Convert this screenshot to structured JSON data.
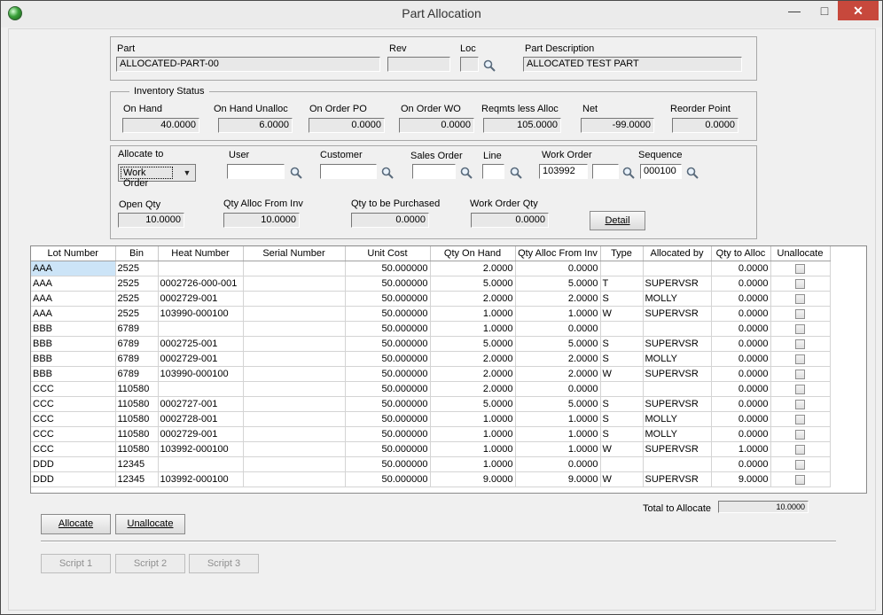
{
  "window": {
    "title": "Part Allocation",
    "min_glyph": "—",
    "max_glyph": "□",
    "close_glyph": "✕"
  },
  "part": {
    "part_label": "Part",
    "part_value": "ALLOCATED-PART-00",
    "rev_label": "Rev",
    "rev_value": "",
    "loc_label": "Loc",
    "loc_value": "",
    "desc_label": "Part Description",
    "desc_value": "ALLOCATED TEST PART"
  },
  "inventory": {
    "legend": "Inventory Status",
    "fields": [
      {
        "label": "On Hand",
        "value": "40.0000"
      },
      {
        "label": "On Hand Unalloc",
        "value": "6.0000"
      },
      {
        "label": "On Order PO",
        "value": "0.0000"
      },
      {
        "label": "On Order WO",
        "value": "0.0000"
      },
      {
        "label": "Reqmts less Alloc",
        "value": "105.0000"
      },
      {
        "label": "Net",
        "value": "-99.0000"
      },
      {
        "label": "Reorder Point",
        "value": "0.0000"
      }
    ]
  },
  "allocate": {
    "allocate_to_label": "Allocate to",
    "allocate_to_value": "Work Order",
    "user_label": "User",
    "user_value": "",
    "customer_label": "Customer",
    "customer_value": "",
    "sales_order_label": "Sales Order",
    "sales_order_value": "",
    "line_label": "Line",
    "line_value": "",
    "work_order_label": "Work Order",
    "work_order_value": "103992",
    "work_order_suffix": "",
    "sequence_label": "Sequence",
    "sequence_value": "000100",
    "open_qty_label": "Open Qty",
    "open_qty_value": "10.0000",
    "qty_alloc_inv_label": "Qty Alloc From Inv",
    "qty_alloc_inv_value": "10.0000",
    "qty_purchased_label": "Qty to be Purchased",
    "qty_purchased_value": "0.0000",
    "wo_qty_label": "Work Order Qty",
    "wo_qty_value": "0.0000",
    "detail_button": "Detail"
  },
  "grid": {
    "columns": [
      "Lot Number",
      "Bin",
      "Heat Number",
      "Serial Number",
      "Unit Cost",
      "Qty On Hand",
      "Qty Alloc From Inv",
      "Type",
      "Allocated by",
      "Qty to Alloc",
      "Unallocate"
    ],
    "rows": [
      {
        "lot": "AAA",
        "bin": "2525",
        "heat": "",
        "serial": "",
        "cost": "50.000000",
        "onhand": "2.0000",
        "alloc": "0.0000",
        "type": "",
        "by": "",
        "toalloc": "0.0000"
      },
      {
        "lot": "AAA",
        "bin": "2525",
        "heat": "0002726-000-001",
        "serial": "",
        "cost": "50.000000",
        "onhand": "5.0000",
        "alloc": "5.0000",
        "type": "T",
        "by": "SUPERVSR",
        "toalloc": "0.0000"
      },
      {
        "lot": "AAA",
        "bin": "2525",
        "heat": "0002729-001",
        "serial": "",
        "cost": "50.000000",
        "onhand": "2.0000",
        "alloc": "2.0000",
        "type": "S",
        "by": "MOLLY",
        "toalloc": "0.0000"
      },
      {
        "lot": "AAA",
        "bin": "2525",
        "heat": "103990-000100",
        "serial": "",
        "cost": "50.000000",
        "onhand": "1.0000",
        "alloc": "1.0000",
        "type": "W",
        "by": "SUPERVSR",
        "toalloc": "0.0000"
      },
      {
        "lot": "BBB",
        "bin": "6789",
        "heat": "",
        "serial": "",
        "cost": "50.000000",
        "onhand": "1.0000",
        "alloc": "0.0000",
        "type": "",
        "by": "",
        "toalloc": "0.0000"
      },
      {
        "lot": "BBB",
        "bin": "6789",
        "heat": "0002725-001",
        "serial": "",
        "cost": "50.000000",
        "onhand": "5.0000",
        "alloc": "5.0000",
        "type": "S",
        "by": "SUPERVSR",
        "toalloc": "0.0000"
      },
      {
        "lot": "BBB",
        "bin": "6789",
        "heat": "0002729-001",
        "serial": "",
        "cost": "50.000000",
        "onhand": "2.0000",
        "alloc": "2.0000",
        "type": "S",
        "by": "MOLLY",
        "toalloc": "0.0000"
      },
      {
        "lot": "BBB",
        "bin": "6789",
        "heat": "103990-000100",
        "serial": "",
        "cost": "50.000000",
        "onhand": "2.0000",
        "alloc": "2.0000",
        "type": "W",
        "by": "SUPERVSR",
        "toalloc": "0.0000"
      },
      {
        "lot": "CCC",
        "bin": "110580",
        "heat": "",
        "serial": "",
        "cost": "50.000000",
        "onhand": "2.0000",
        "alloc": "0.0000",
        "type": "",
        "by": "",
        "toalloc": "0.0000"
      },
      {
        "lot": "CCC",
        "bin": "110580",
        "heat": "0002727-001",
        "serial": "",
        "cost": "50.000000",
        "onhand": "5.0000",
        "alloc": "5.0000",
        "type": "S",
        "by": "SUPERVSR",
        "toalloc": "0.0000"
      },
      {
        "lot": "CCC",
        "bin": "110580",
        "heat": "0002728-001",
        "serial": "",
        "cost": "50.000000",
        "onhand": "1.0000",
        "alloc": "1.0000",
        "type": "S",
        "by": "MOLLY",
        "toalloc": "0.0000"
      },
      {
        "lot": "CCC",
        "bin": "110580",
        "heat": "0002729-001",
        "serial": "",
        "cost": "50.000000",
        "onhand": "1.0000",
        "alloc": "1.0000",
        "type": "S",
        "by": "MOLLY",
        "toalloc": "0.0000"
      },
      {
        "lot": "CCC",
        "bin": "110580",
        "heat": "103992-000100",
        "serial": "",
        "cost": "50.000000",
        "onhand": "1.0000",
        "alloc": "1.0000",
        "type": "W",
        "by": "SUPERVSR",
        "toalloc": "1.0000"
      },
      {
        "lot": "DDD",
        "bin": "12345",
        "heat": "",
        "serial": "",
        "cost": "50.000000",
        "onhand": "1.0000",
        "alloc": "0.0000",
        "type": "",
        "by": "",
        "toalloc": "0.0000"
      },
      {
        "lot": "DDD",
        "bin": "12345",
        "heat": "103992-000100",
        "serial": "",
        "cost": "50.000000",
        "onhand": "9.0000",
        "alloc": "9.0000",
        "type": "W",
        "by": "SUPERVSR",
        "toalloc": "9.0000"
      }
    ]
  },
  "footer": {
    "total_label": "Total to Allocate",
    "total_value": "10.0000",
    "allocate_button": "Allocate",
    "unallocate_button": "Unallocate",
    "script1": "Script 1",
    "script2": "Script 2",
    "script3": "Script 3"
  }
}
